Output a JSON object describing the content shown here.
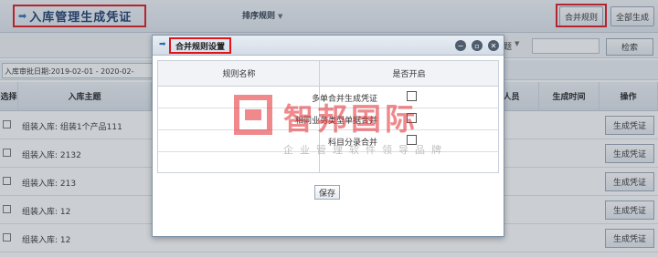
{
  "header": {
    "title": "入库管理生成凭证",
    "sort_rule_label": "排序规则",
    "merge_rule_button": "合并规则",
    "generate_all_button": "全部生成"
  },
  "filter": {
    "select_label": "题",
    "search_button": "检索",
    "date_label": "入库审批日期:2019-02-01 - 2020-02-"
  },
  "table": {
    "headers": {
      "select": "选择",
      "subject": "入库主题",
      "person": "人员",
      "gen_time": "生成时间",
      "action": "操作"
    },
    "rows": [
      {
        "subject": "组装入库: 组装1个产品111",
        "action": "生成凭证"
      },
      {
        "subject": "组装入库: 2132",
        "action": "生成凭证"
      },
      {
        "subject": "组装入库: 213",
        "action": "生成凭证"
      },
      {
        "subject": "组装入库: 12",
        "action": "生成凭证"
      },
      {
        "subject": "组装入库: 12",
        "action": "生成凭证"
      }
    ]
  },
  "modal": {
    "title": "合并规则设置",
    "col_rule_name": "规则名称",
    "col_enabled": "是否开启",
    "rules": [
      {
        "name": "多单合并生成凭证",
        "enabled": false
      },
      {
        "name": "相同业务类型单据合并",
        "enabled": false
      },
      {
        "name": "科目分录合并",
        "enabled": false
      }
    ],
    "save_button": "保存"
  },
  "watermark": {
    "main": "智邦国际",
    "sub": "企业管理软件领导品牌"
  },
  "colors": {
    "highlight": "#e0151c",
    "header_text": "#1a3a6b"
  }
}
